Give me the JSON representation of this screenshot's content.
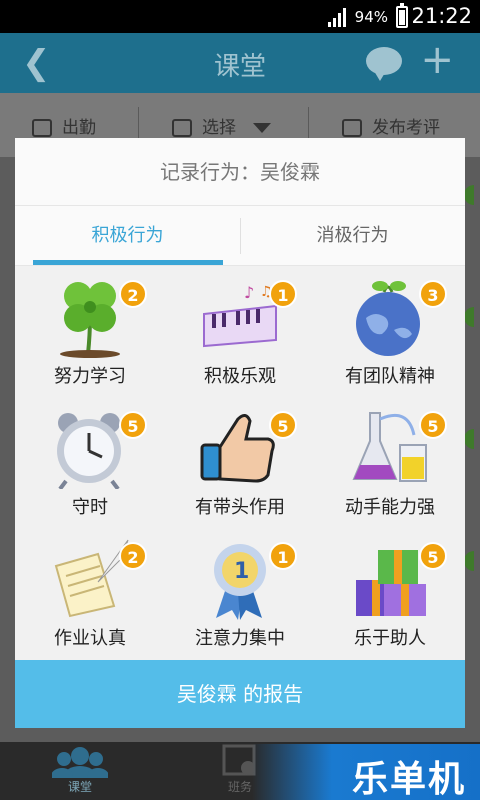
{
  "status_bar": {
    "battery_percent": "94%",
    "time": "21:22"
  },
  "app_bar": {
    "title": "课堂",
    "back_icon": "chevron-left-icon",
    "chat_icon": "chat-bubble-icon",
    "add_icon": "plus-icon"
  },
  "toolbar": {
    "attendance": "出勤",
    "select": "选择",
    "publish_review": "发布考评"
  },
  "dialog": {
    "title": "记录行为：吴俊霖",
    "tabs": [
      {
        "label": "积极行为"
      },
      {
        "label": "消极行为"
      }
    ],
    "behaviors": [
      {
        "label": "努力学习",
        "count": "2",
        "icon": "clover-icon"
      },
      {
        "label": "积极乐观",
        "count": "1",
        "icon": "piano-icon"
      },
      {
        "label": "有团队精神",
        "count": "3",
        "icon": "globe-icon"
      },
      {
        "label": "守时",
        "count": "5",
        "icon": "alarm-clock-icon"
      },
      {
        "label": "有带头作用",
        "count": "5",
        "icon": "thumbs-up-icon"
      },
      {
        "label": "动手能力强",
        "count": "5",
        "icon": "lab-flask-icon"
      },
      {
        "label": "作业认真",
        "count": "2",
        "icon": "paper-quill-icon"
      },
      {
        "label": "注意力集中",
        "count": "1",
        "icon": "medal-icon"
      },
      {
        "label": "乐于助人",
        "count": "5",
        "icon": "gift-icon"
      }
    ],
    "report_button": "吴俊霖 的报告"
  },
  "bottom_nav": {
    "items": [
      {
        "label": "课堂"
      },
      {
        "label": "班务"
      }
    ]
  },
  "watermark": "乐单机",
  "colors": {
    "accent": "#3aa5d6",
    "badge": "#f1a20c",
    "report_button": "#54bde9",
    "header": "#1e6f8d"
  }
}
